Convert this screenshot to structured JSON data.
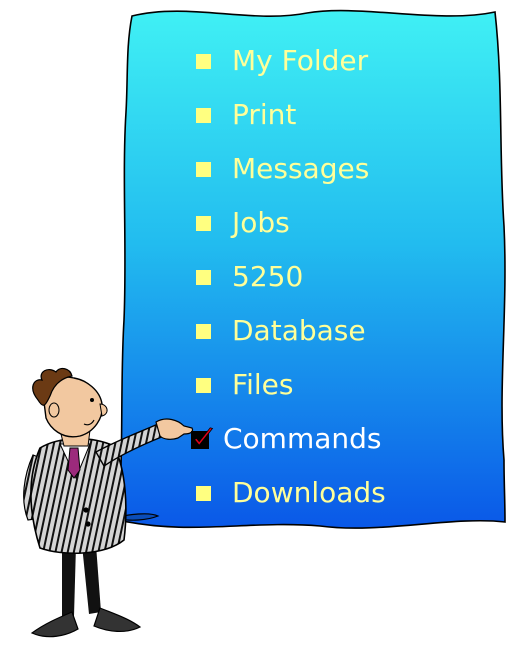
{
  "menu": {
    "items": [
      {
        "label": "My Folder",
        "icon": "square-bullet-icon",
        "selected": false
      },
      {
        "label": "Print",
        "icon": "square-bullet-icon",
        "selected": false
      },
      {
        "label": "Messages",
        "icon": "square-bullet-icon",
        "selected": false
      },
      {
        "label": "Jobs",
        "icon": "square-bullet-icon",
        "selected": false
      },
      {
        "label": "5250",
        "icon": "square-bullet-icon",
        "selected": false
      },
      {
        "label": "Database",
        "icon": "square-bullet-icon",
        "selected": false
      },
      {
        "label": "Files",
        "icon": "square-bullet-icon",
        "selected": false
      },
      {
        "label": "Commands",
        "icon": "checkmark-box-icon",
        "selected": true
      },
      {
        "label": "Downloads",
        "icon": "square-bullet-icon",
        "selected": false
      }
    ]
  },
  "colors": {
    "panel_top": "#40f0f4",
    "panel_bottom": "#0a58e8",
    "bullet": "#ffff80",
    "label": "#ffff99",
    "selected_label": "#ffffff",
    "check": "#e0001b"
  },
  "presenter": {
    "icon": "presenter-man-pointing-clipart"
  }
}
